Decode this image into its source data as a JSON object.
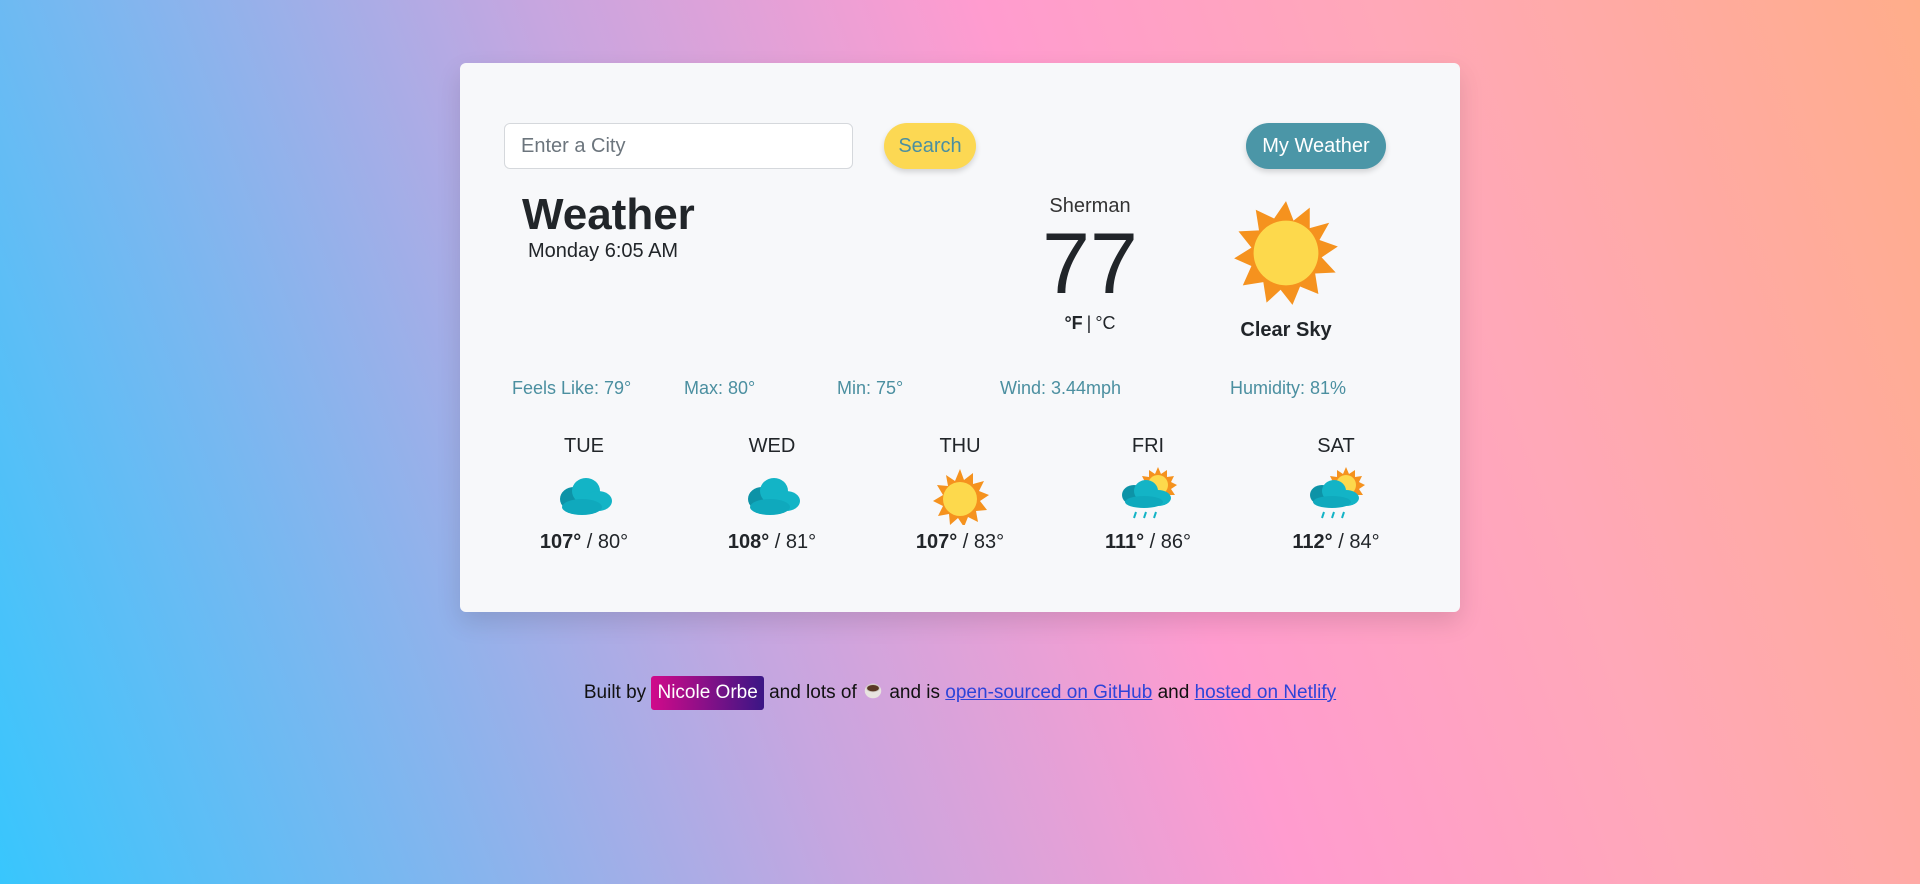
{
  "search": {
    "placeholder": "Enter a City",
    "button_label": "Search"
  },
  "my_weather_label": "My Weather",
  "header": {
    "title": "Weather",
    "date": "Monday 6:05 AM"
  },
  "current": {
    "city": "Sherman",
    "temperature": "77",
    "unit_f": "°F",
    "unit_sep": "|",
    "unit_c": "°C",
    "description": "Clear Sky",
    "icon": "sun-icon"
  },
  "stats": {
    "feels_like": "Feels Like: 79°",
    "max": "Max: 80°",
    "min": "Min: 75°",
    "wind": "Wind: 3.44mph",
    "humidity": "Humidity: 81%"
  },
  "forecast": [
    {
      "day": "TUE",
      "high": "107°",
      "low": " / 80°",
      "icon": "clouds-icon"
    },
    {
      "day": "WED",
      "high": "108°",
      "low": " / 81°",
      "icon": "clouds-icon"
    },
    {
      "day": "THU",
      "high": "107°",
      "low": " / 83°",
      "icon": "sun-icon"
    },
    {
      "day": "FRI",
      "high": "111°",
      "low": " / 86°",
      "icon": "sun-rain-icon"
    },
    {
      "day": "SAT",
      "high": "112°",
      "low": " / 84°",
      "icon": "sun-rain-icon"
    }
  ],
  "footer": {
    "built_by": "Built by",
    "author": "Nicole Orbe",
    "and_lots_of": "and lots of",
    "and_is": "and is",
    "github_link": "open-sourced on GitHub",
    "and": "and",
    "netlify_link": "hosted on Netlify",
    "coffee_icon": "coffee-icon"
  },
  "colors": {
    "search_button": "#fcd853",
    "my_weather_button": "#4b96a7",
    "stat_text": "#4b8fa0",
    "link": "#2d44d8"
  }
}
